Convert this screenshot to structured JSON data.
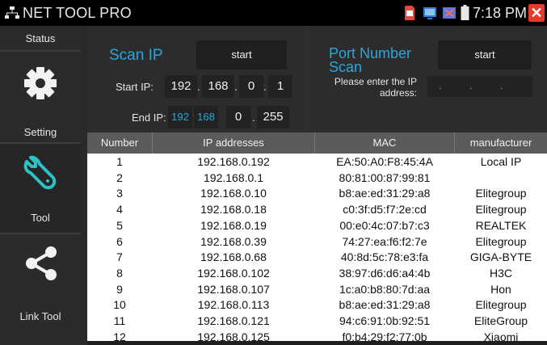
{
  "status_bar": {
    "app_title": "NET TOOL PRO",
    "time": "7:18 PM"
  },
  "sidebar": {
    "items": [
      {
        "label": "Status",
        "icon": "status-icon"
      },
      {
        "label": "Setting",
        "icon": "gear-icon"
      },
      {
        "label": "Tool",
        "icon": "wrench-icon"
      },
      {
        "label": "Link Tool",
        "icon": "share-icon"
      }
    ]
  },
  "scan_panel": {
    "title": "Scan IP",
    "start_button": "start",
    "start_ip_label": "Start IP:",
    "start_ip": [
      "192",
      "168",
      "0",
      "1"
    ],
    "end_ip_label": "End IP:",
    "end_ip": [
      "192",
      "168",
      "0",
      "255"
    ]
  },
  "port_panel": {
    "title": "Port Number Scan",
    "start_button": "start",
    "prompt": "Please enter the IP address:",
    "ip_dots": [
      ".",
      ".",
      "."
    ]
  },
  "table": {
    "headers": [
      "Number",
      "IP addresses",
      "MAC",
      "manufacturer"
    ],
    "rows": [
      [
        "1",
        "192.168.0.192",
        "EA:50:A0:F8:45:4A",
        "Local IP"
      ],
      [
        "2",
        "192.168.0.1",
        "80:81:00:87:99:81",
        ""
      ],
      [
        "3",
        "192.168.0.10",
        "b8:ae:ed:31:29:a8",
        "Elitegroup"
      ],
      [
        "4",
        "192.168.0.18",
        "c0:3f:d5:f7:2e:cd",
        "Elitegroup"
      ],
      [
        "5",
        "192.168.0.19",
        "00:e0:4c:07:b7:c3",
        "REALTEK"
      ],
      [
        "6",
        "192.168.0.39",
        "74:27:ea:f6:f2:7e",
        "Elitegroup"
      ],
      [
        "7",
        "192.168.0.68",
        "40:8d:5c:78:e3:fa",
        "GIGA-BYTE"
      ],
      [
        "8",
        "192.168.0.102",
        "38:97:d6:d6:a4:4b",
        "H3C"
      ],
      [
        "9",
        "192.168.0.107",
        "1c:a0:b8:80:7d:aa",
        "Hon"
      ],
      [
        "10",
        "192.168.0.113",
        "b8:ae:ed:31:29:a8",
        "Elitegroup"
      ],
      [
        "11",
        "192.168.0.121",
        "94:c6:91:0b:92:51",
        "EliteGroup"
      ],
      [
        "12",
        "192.168.0.125",
        "f0:b4:29:f2:77:0b",
        "Xiaomi"
      ]
    ]
  },
  "colors": {
    "accent_blue": "#25a8e0",
    "close_red": "#e53b2b"
  }
}
